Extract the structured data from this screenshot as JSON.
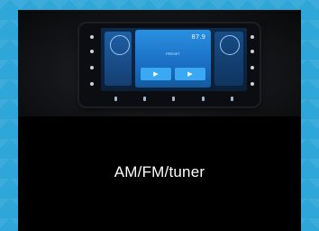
{
  "caption": "AM/FM/tuner",
  "screen": {
    "frequency": "87.9",
    "preset_label": "PRESET"
  },
  "colors": {
    "background": "#2ea6d8",
    "card": "#000000",
    "caption_text": "#ffffff"
  },
  "icons": [
    "tile-icon",
    "play-icon",
    "clock-icon"
  ]
}
